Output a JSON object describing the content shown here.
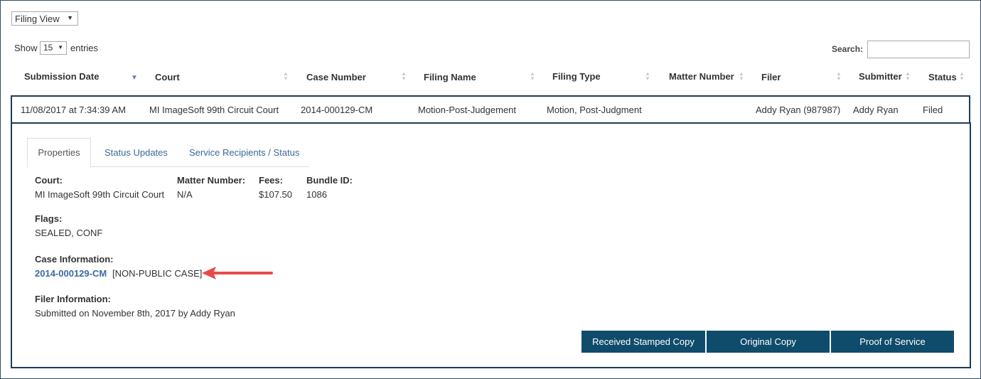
{
  "view_select": {
    "value": "Filing View"
  },
  "length": {
    "show_label": "Show",
    "value": "15",
    "entries_label": "entries"
  },
  "search": {
    "label": "Search:",
    "placeholder": ""
  },
  "table": {
    "columns": [
      "Submission Date",
      "Court",
      "Case Number",
      "Filing Name",
      "Filing Type",
      "Matter Number",
      "Filer",
      "Submitter",
      "Status"
    ],
    "row": [
      "11/08/2017 at 7:34:39 AM",
      "MI ImageSoft 99th Circuit Court",
      "2014-000129-CM",
      "Motion-Post-Judgement",
      "Motion, Post-Judgment",
      "",
      "Addy Ryan (987987)",
      "Addy Ryan",
      "Filed"
    ]
  },
  "tabs": [
    "Properties",
    "Status Updates",
    "Service Recipients / Status"
  ],
  "properties": {
    "court_label": "Court:",
    "court_value": "MI ImageSoft 99th Circuit Court",
    "matter_label": "Matter Number:",
    "matter_value": "N/A",
    "fees_label": "Fees:",
    "fees_value": "$107.50",
    "bundle_label": "Bundle ID:",
    "bundle_value": "1086",
    "flags_label": "Flags:",
    "flags_value": "SEALED, CONF",
    "case_label": "Case Information:",
    "case_link": "2014-000129-CM",
    "case_note": "[NON-PUBLIC CASE]",
    "filer_label": "Filer Information:",
    "filer_value": "Submitted on November 8th, 2017 by Addy Ryan"
  },
  "buttons": [
    "Received Stamped Copy",
    "Original Copy",
    "Proof of Service"
  ],
  "colors": {
    "button": "#0f4c6b",
    "border": "#1f3b57",
    "link": "#3a6aa0",
    "annotation_arrow": "#e84a4a"
  }
}
